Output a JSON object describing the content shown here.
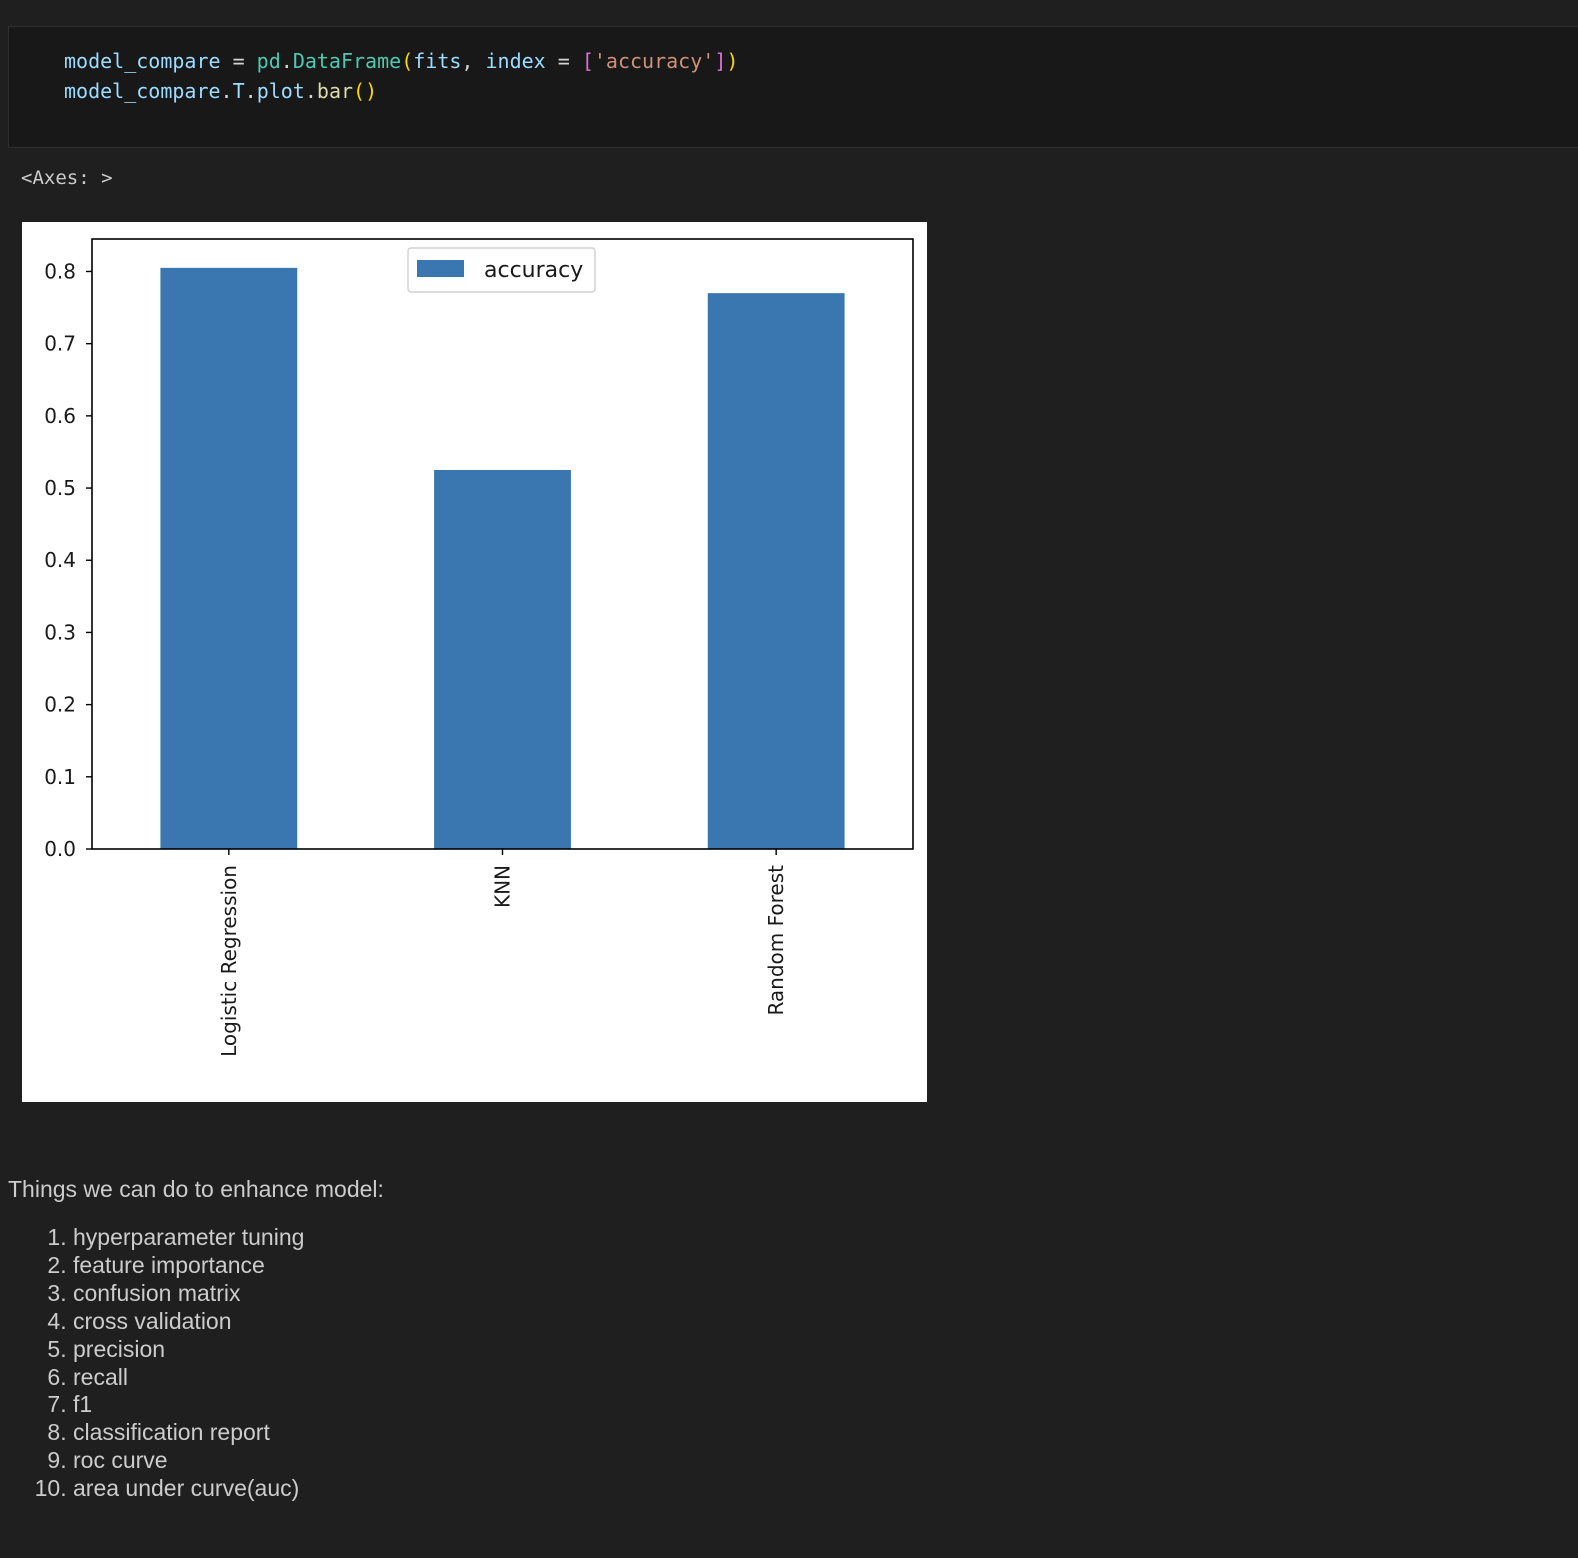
{
  "code_cell": {
    "line1": {
      "var": "model_compare",
      "eq": " = ",
      "mod": "pd",
      "dot": ".",
      "cls": "DataFrame",
      "open": "(",
      "arg1": "fits",
      "comma": ", ",
      "kw": "index",
      "eq2": " = ",
      "lbr": "[",
      "str": "'accuracy'",
      "rbr": "]",
      "close": ")"
    },
    "line2": {
      "var": "model_compare",
      "dot1": ".",
      "attr1": "T",
      "dot2": ".",
      "attr2": "plot",
      "dot3": ".",
      "fn": "bar",
      "parens": "()"
    }
  },
  "output": {
    "repr": "<Axes: >"
  },
  "chart_data": {
    "type": "bar",
    "categories": [
      "Logistic Regression",
      "KNN",
      "Random Forest"
    ],
    "series": [
      {
        "name": "accuracy",
        "values": [
          0.805,
          0.525,
          0.77
        ]
      }
    ],
    "ylim": [
      0,
      0.845
    ],
    "yticks": [
      0.0,
      0.1,
      0.2,
      0.3,
      0.4,
      0.5,
      0.6,
      0.7,
      0.8
    ],
    "ytick_labels": [
      "0.0",
      "0.1",
      "0.2",
      "0.3",
      "0.4",
      "0.5",
      "0.6",
      "0.7",
      "0.8"
    ],
    "legend": "top-center",
    "bar_color": "#3a76b0",
    "grid": false
  },
  "markdown": {
    "intro": "Things we can do to enhance model:",
    "items": [
      "hyperparameter tuning",
      "feature importance",
      "confusion matrix",
      "cross validation",
      "precision",
      "recall",
      "f1",
      "classification report",
      "roc curve",
      "area under curve(auc)"
    ]
  }
}
